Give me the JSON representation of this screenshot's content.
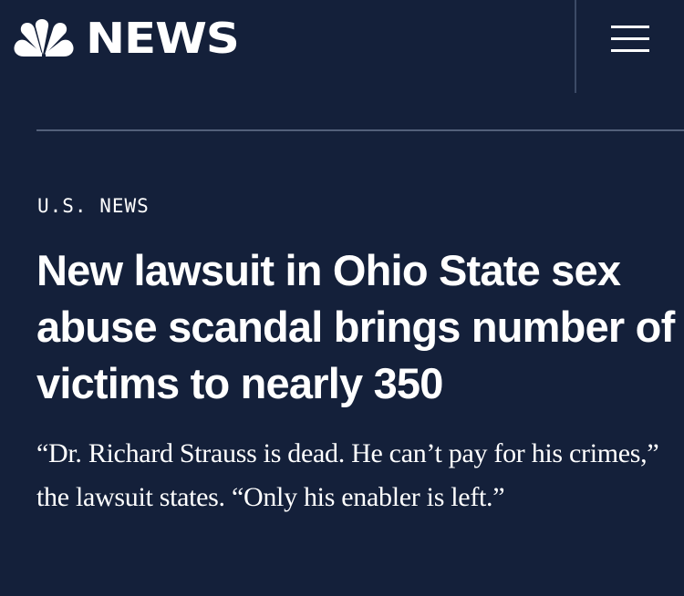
{
  "header": {
    "brand": "NEWS",
    "logo_icon": "nbc-peacock-icon",
    "menu_icon": "hamburger-menu-icon"
  },
  "article": {
    "section": "U.S. NEWS",
    "headline": "New lawsuit in Ohio State sex abuse scandal brings number of victims to nearly 350",
    "dek": "“Dr. Richard Strauss is dead. He can’t pay for his crimes,” the lawsuit states. “Only his enabler is left.”"
  },
  "colors": {
    "background": "#14203a",
    "text": "#ffffff",
    "divider": "#53607a"
  }
}
